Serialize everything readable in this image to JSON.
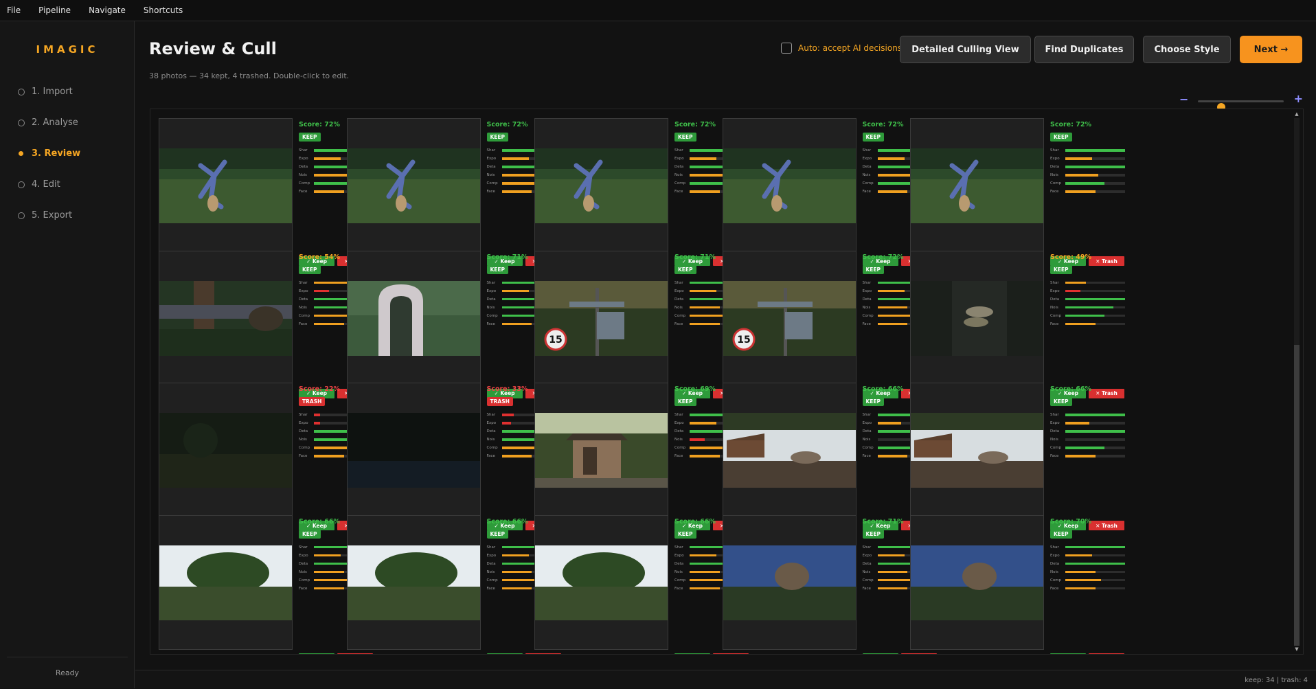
{
  "menu": [
    "File",
    "Pipeline",
    "Navigate",
    "Shortcuts"
  ],
  "sidebar": {
    "logo": "IMAGIC",
    "steps": [
      {
        "label": "1. Import",
        "active": false
      },
      {
        "label": "2. Analyse",
        "active": false
      },
      {
        "label": "3. Review",
        "active": true
      },
      {
        "label": "4. Edit",
        "active": false
      },
      {
        "label": "5. Export",
        "active": false
      }
    ],
    "status": "Ready"
  },
  "header": {
    "title": "Review & Cull",
    "subtitle": "38 photos — 34 kept, 4 trashed. Double-click to edit.",
    "auto_label": "Auto: accept AI decisions",
    "auto_checked": false,
    "buttons": {
      "detailed": "Detailed Culling View",
      "duplicates": "Find Duplicates",
      "style": "Choose Style",
      "next": "Next →"
    }
  },
  "zoom": {
    "minus": "−",
    "plus": "+",
    "level": 0.27
  },
  "labels": {
    "score_prefix": "Score: ",
    "keep_btn": "✓ Keep",
    "trash_btn": "✕ Trash",
    "metrics": [
      "Shar",
      "Expo",
      "Deta",
      "Nois",
      "Comp",
      "Face"
    ]
  },
  "colors": {
    "accent": "#f5a623",
    "good": "#3fbf4a",
    "mid": "#f0a020",
    "bad": "#e03030",
    "score_good": "#3fbf4a",
    "score_mid": "#f5a623",
    "score_bad": "#ef4444"
  },
  "photos": [
    {
      "file": "DSC03093.ARW",
      "score": "72%",
      "decision": "KEEP",
      "scene": "cartwheel",
      "metrics": [
        1.0,
        0.45,
        1.0,
        0.55,
        0.65,
        0.5
      ]
    },
    {
      "file": "DSC03094.ARW",
      "score": "72%",
      "decision": "KEEP",
      "scene": "cartwheel",
      "metrics": [
        1.0,
        0.45,
        1.0,
        0.55,
        0.6,
        0.5
      ]
    },
    {
      "file": "DSC03095.ARW",
      "score": "72%",
      "decision": "KEEP",
      "scene": "cartwheel",
      "metrics": [
        1.0,
        0.45,
        1.0,
        0.55,
        0.65,
        0.5
      ]
    },
    {
      "file": "DSC03096.ARW",
      "score": "72%",
      "decision": "KEEP",
      "scene": "cartwheel",
      "metrics": [
        1.0,
        0.45,
        1.0,
        0.55,
        0.65,
        0.5
      ]
    },
    {
      "file": "DSC03098.ARW",
      "score": "72%",
      "decision": "KEEP",
      "scene": "cartwheel",
      "metrics": [
        1.0,
        0.45,
        1.0,
        0.55,
        0.65,
        0.5
      ]
    },
    {
      "file": "DSC03108.ARW",
      "score": "54%",
      "decision": "KEEP",
      "scene": "woods",
      "metrics": [
        0.6,
        0.25,
        1.0,
        0.8,
        0.6,
        0.5
      ]
    },
    {
      "file": "DSC03124.ARW",
      "score": "71%",
      "decision": "KEEP",
      "scene": "statue",
      "metrics": [
        0.9,
        0.45,
        1.0,
        0.8,
        0.65,
        0.5
      ]
    },
    {
      "file": "DSC03229.ARW",
      "score": "71%",
      "decision": "KEEP",
      "scene": "signpost",
      "metrics": [
        1.0,
        0.45,
        1.0,
        0.5,
        0.6,
        0.5
      ]
    },
    {
      "file": "DSC03230.ARW",
      "score": "72%",
      "decision": "KEEP",
      "scene": "signpost",
      "metrics": [
        1.0,
        0.45,
        1.0,
        0.5,
        0.6,
        0.5
      ]
    },
    {
      "file": "DSC03435.ARW",
      "score": "49%",
      "decision": "KEEP",
      "scene": "fungus",
      "metrics": [
        0.35,
        0.25,
        1.0,
        0.8,
        0.65,
        0.5
      ]
    },
    {
      "file": "DSC03452.ARW",
      "score": "22%",
      "decision": "TRASH",
      "scene": "dark",
      "metrics": [
        0.1,
        0.1,
        1.0,
        0.9,
        0.6,
        0.5
      ]
    },
    {
      "file": "DSC03453.ARW",
      "score": "33%",
      "decision": "TRASH",
      "scene": "darkwater",
      "metrics": [
        0.2,
        0.15,
        1.0,
        1.0,
        0.55,
        0.5
      ]
    },
    {
      "file": "DSC03542.ARW",
      "score": "69%",
      "decision": "KEEP",
      "scene": "shed",
      "metrics": [
        1.0,
        0.45,
        1.0,
        0.25,
        0.6,
        0.5
      ]
    },
    {
      "file": "DSC03850.ARW",
      "score": "66%",
      "decision": "KEEP",
      "scene": "farm",
      "metrics": [
        1.0,
        0.4,
        1.0,
        0.0,
        0.65,
        0.5
      ]
    },
    {
      "file": "DSC03851.ARW",
      "score": "66%",
      "decision": "KEEP",
      "scene": "farm",
      "metrics": [
        1.0,
        0.4,
        1.0,
        0.0,
        0.65,
        0.5
      ]
    },
    {
      "file": "",
      "score": "66%",
      "decision": "KEEP",
      "scene": "trees",
      "metrics": [
        1.0,
        0.45,
        1.0,
        0.5,
        0.6,
        0.5
      ]
    },
    {
      "file": "",
      "score": "66%",
      "decision": "KEEP",
      "scene": "trees",
      "metrics": [
        1.0,
        0.45,
        1.0,
        0.5,
        0.6,
        0.5
      ]
    },
    {
      "file": "",
      "score": "66%",
      "decision": "KEEP",
      "scene": "trees",
      "metrics": [
        1.0,
        0.45,
        1.0,
        0.5,
        0.6,
        0.5
      ]
    },
    {
      "file": "",
      "score": "71%",
      "decision": "KEEP",
      "scene": "animal",
      "metrics": [
        1.0,
        0.45,
        1.0,
        0.5,
        0.6,
        0.5
      ]
    },
    {
      "file": "",
      "score": "70%",
      "decision": "KEEP",
      "scene": "animal",
      "metrics": [
        1.0,
        0.45,
        1.0,
        0.5,
        0.6,
        0.5
      ]
    }
  ],
  "status": {
    "counts": "keep: 34  |  trash: 4"
  }
}
